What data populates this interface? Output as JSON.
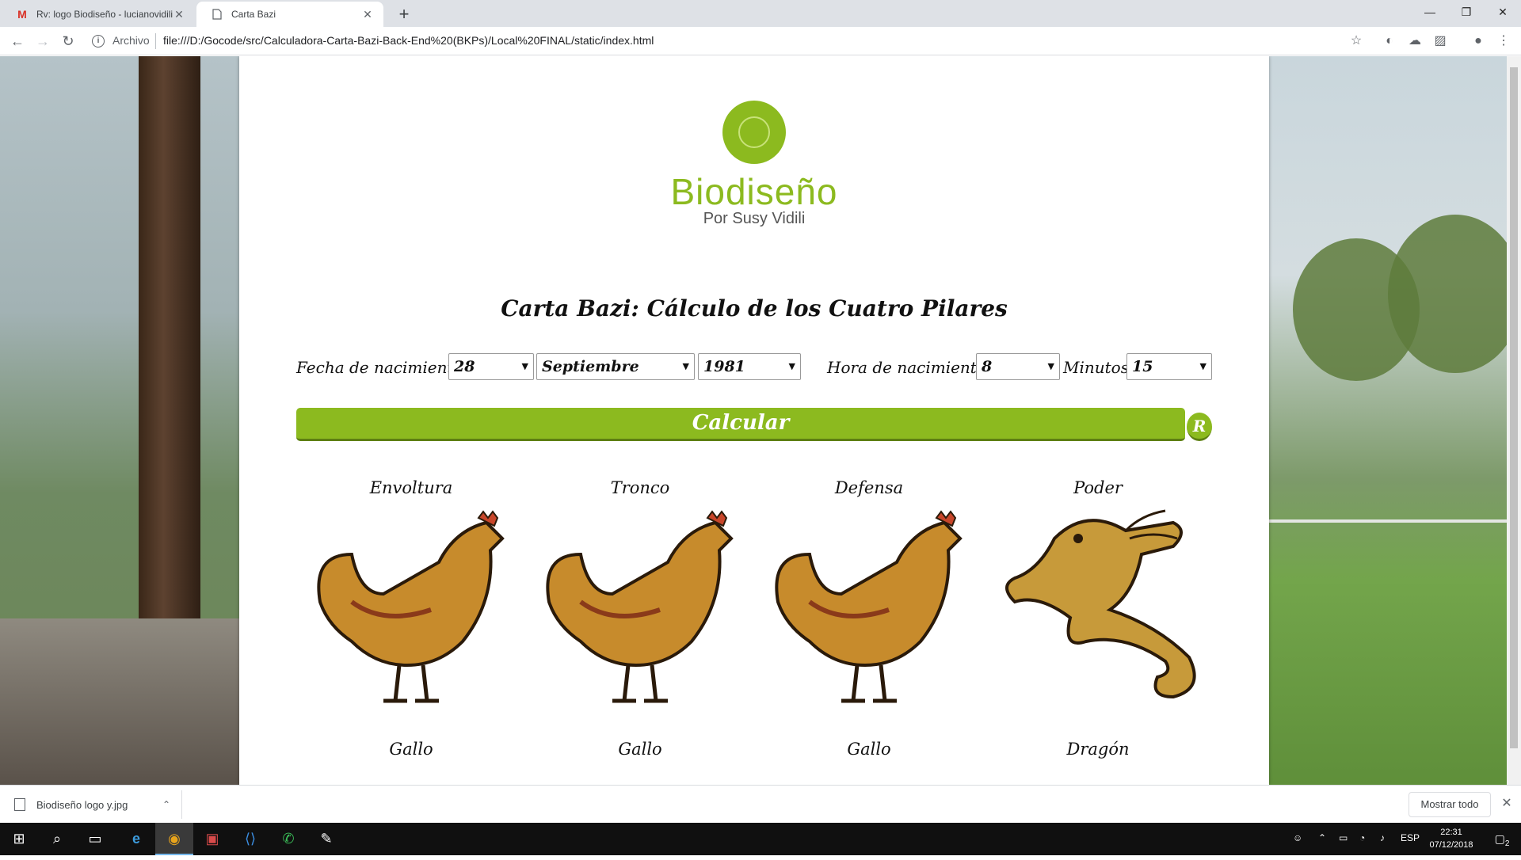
{
  "browser": {
    "tabs": [
      {
        "title": "Rv: logo Biodiseño - lucianovidili",
        "favicon": "gmail-icon"
      },
      {
        "title": "Carta Bazi",
        "favicon": "page-icon"
      }
    ],
    "security_label": "Archivo",
    "url": "file:///D:/Gocode/src/Calculadora-Carta-Bazi-Back-End%20(BKPs)/Local%20FINAL/static/index.html"
  },
  "logo": {
    "name": "Biodiseño",
    "subtitle": "Por Susy Vidili",
    "color": "#8cba1f"
  },
  "page": {
    "title": "Carta Bazi: Cálculo de los Cuatro Pilares",
    "form": {
      "birth_date_label": "Fecha de nacimiento:",
      "day": "28",
      "month": "Septiembre",
      "year": "1981",
      "birth_time_label": "Hora de nacimiento:",
      "hour": "8",
      "minutes_label": "Minutos:",
      "minutes": "15"
    },
    "calculate_label": "Calcular",
    "reset_label": "R"
  },
  "pillars": [
    {
      "title": "Envoltura",
      "animal": "Gallo"
    },
    {
      "title": "Tronco",
      "animal": "Gallo"
    },
    {
      "title": "Defensa",
      "animal": "Gallo"
    },
    {
      "title": "Poder",
      "animal": "Dragón"
    }
  ],
  "downloads": {
    "file": "Biodiseño logo y.jpg",
    "show_all": "Mostrar todo"
  },
  "taskbar": {
    "lang": "ESP",
    "time": "22:31",
    "date": "07/12/2018",
    "notifications": "2"
  }
}
